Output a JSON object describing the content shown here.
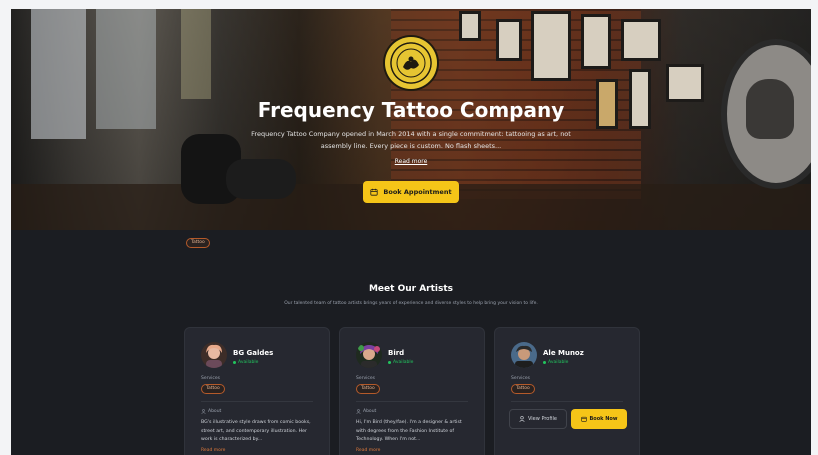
{
  "hero": {
    "title": "Frequency Tattoo Company",
    "description": "Frequency Tattoo Company opened in March 2014 with a single commitment: tattooing as art, not assembly line. Every piece is custom. No flash sheets...",
    "read_more": "Read more",
    "book_button": "Book Appointment",
    "logo_icon": "shop-logo-seal"
  },
  "tags": [
    "Tattoo"
  ],
  "artists_section": {
    "title": "Meet Our Artists",
    "subtitle": "Our talented team of tattoo artists brings years of experience and diverse styles to help bring your vision to life."
  },
  "artists": [
    {
      "name": "BG Galdes",
      "status": "Available",
      "services_label": "Services",
      "service": "Tattoo",
      "about_label": "About",
      "bio": "BG's illustrative style draws from comic books, street art, and contemporary illustration. Her work is characterized by...",
      "read_more": "Read more"
    },
    {
      "name": "Bird",
      "status": "Available",
      "services_label": "Services",
      "service": "Tattoo",
      "about_label": "About",
      "bio": "Hi, I'm Bird (they/fae). I'm a designer & artist with degrees from the Fashion Institute of Technology. When I'm not...",
      "read_more": "Read more"
    },
    {
      "name": "Ale Munoz",
      "status": "Available",
      "services_label": "Services",
      "service": "Tattoo",
      "view_profile": "View Profile",
      "book_now": "Book Now"
    }
  ],
  "colors": {
    "accent": "#f5c518",
    "background": "#1b1d22",
    "card": "#262830",
    "available": "#22c55e",
    "tag_border": "#b45a2a"
  }
}
